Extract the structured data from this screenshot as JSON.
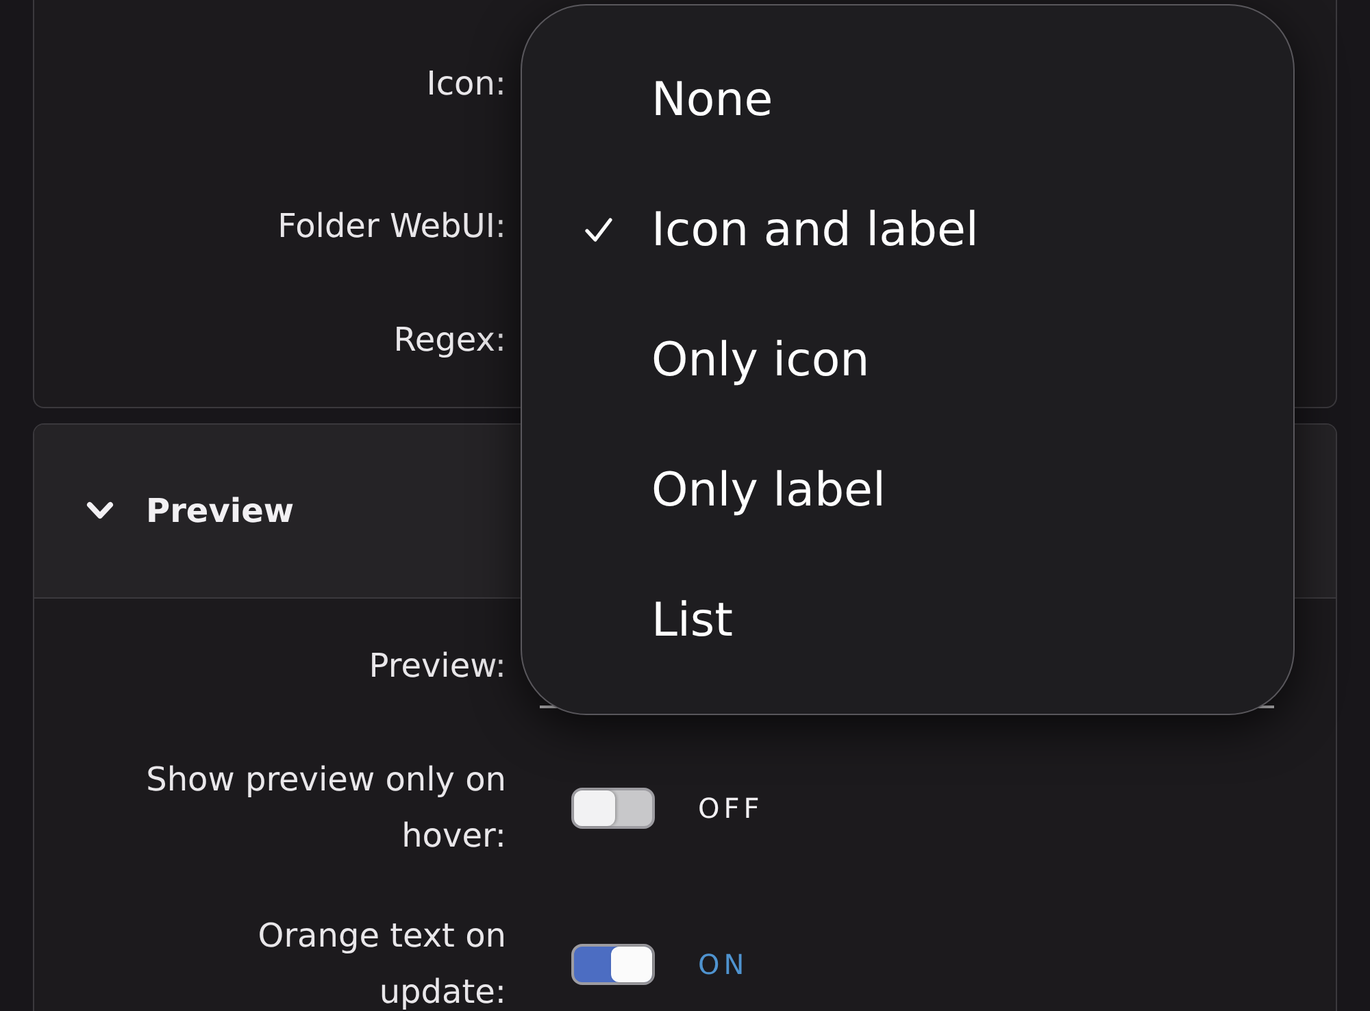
{
  "settings_panel": {
    "rows": [
      {
        "label": "Icon:"
      },
      {
        "label": "Folder WebUI:"
      },
      {
        "label": "Regex:"
      }
    ]
  },
  "preview_section": {
    "title": "Preview",
    "expanded": true,
    "rows": [
      {
        "kind": "input",
        "label": "Preview:"
      },
      {
        "kind": "toggle",
        "label": "Show preview only on hover:",
        "on": false,
        "state_text": "OFF"
      },
      {
        "kind": "toggle",
        "label": "Orange text on update:",
        "on": true,
        "state_text": "ON"
      }
    ]
  },
  "dropdown_menu": {
    "items": [
      {
        "label": "None",
        "selected": false
      },
      {
        "label": "Icon and label",
        "selected": true
      },
      {
        "label": "Only icon",
        "selected": false
      },
      {
        "label": "Only label",
        "selected": false
      },
      {
        "label": "List",
        "selected": false
      }
    ]
  }
}
